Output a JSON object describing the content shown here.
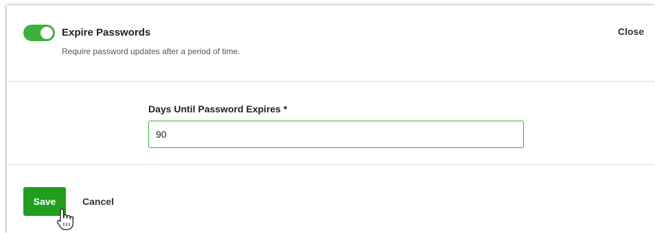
{
  "header": {
    "toggle_on": true,
    "title": "Expire Passwords",
    "subtitle": "Require password updates after a period of time.",
    "close_label": "Close"
  },
  "field": {
    "label": "Days Until Password Expires *",
    "value": "90"
  },
  "footer": {
    "save_label": "Save",
    "cancel_label": "Cancel"
  },
  "colors": {
    "accent": "#3bb03b",
    "save_bg": "#1f9e1f"
  },
  "cursor_icon": "hand-pointer-icon"
}
